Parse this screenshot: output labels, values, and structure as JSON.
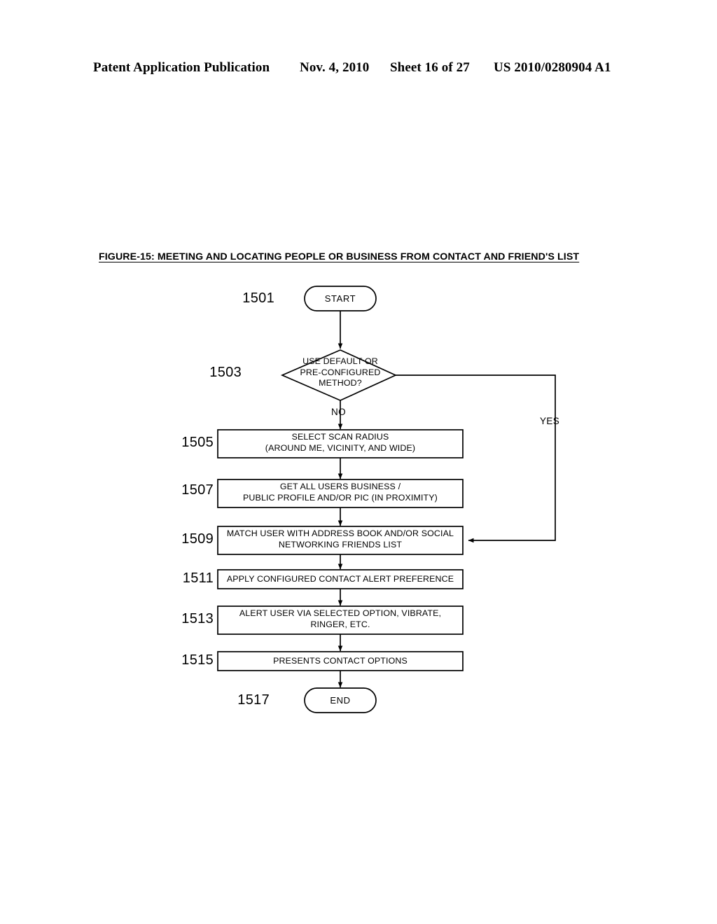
{
  "header": {
    "publication": "Patent Application Publication",
    "date": "Nov. 4, 2010",
    "sheet": "Sheet 16 of 27",
    "patent_number": "US 2010/0280904 A1"
  },
  "figure": {
    "title": "FIGURE-15: MEETING AND LOCATING PEOPLE OR BUSINESS FROM CONTACT AND FRIEND'S LIST",
    "nodes": [
      {
        "ref": "1501",
        "shape": "terminator",
        "text": "START"
      },
      {
        "ref": "1503",
        "shape": "decision",
        "text": "USE DEFAULT OR\nPRE-CONFIGURED\nMETHOD?"
      },
      {
        "ref": "1505",
        "shape": "process",
        "text": "SELECT SCAN RADIUS\n(AROUND ME, VICINITY, AND WIDE)"
      },
      {
        "ref": "1507",
        "shape": "process",
        "text": "GET ALL USERS BUSINESS /\nPUBLIC PROFILE AND/OR PIC (IN PROXIMITY)"
      },
      {
        "ref": "1509",
        "shape": "process",
        "text": "MATCH USER WITH ADDRESS BOOK AND/OR SOCIAL\nNETWORKING FRIENDS LIST"
      },
      {
        "ref": "1511",
        "shape": "process",
        "text": "APPLY CONFIGURED CONTACT ALERT PREFERENCE"
      },
      {
        "ref": "1513",
        "shape": "process",
        "text": "ALERT USER VIA SELECTED OPTION, VIBRATE,\nRINGER, ETC."
      },
      {
        "ref": "1515",
        "shape": "process",
        "text": "PRESENTS CONTACT OPTIONS"
      },
      {
        "ref": "1517",
        "shape": "terminator",
        "text": "END"
      }
    ],
    "branches": {
      "no_label": "NO",
      "yes_label": "YES"
    },
    "line_color": "#000000"
  }
}
